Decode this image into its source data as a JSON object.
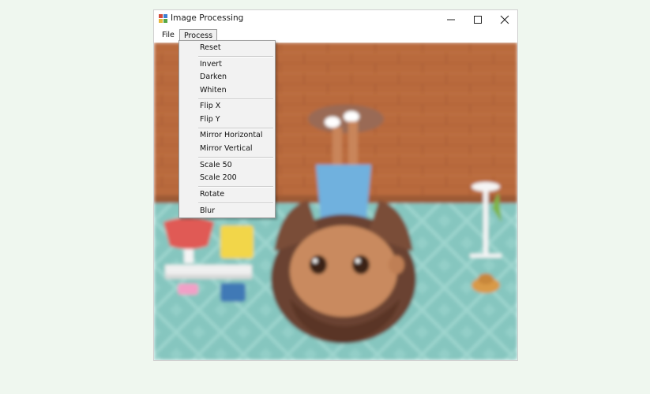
{
  "window": {
    "title": "Image Processing",
    "icon": "app-image-icon",
    "controls": {
      "minimize": "minimize-icon",
      "maximize": "maximize-icon",
      "close": "close-icon"
    }
  },
  "menubar": {
    "file": "File",
    "process": "Process"
  },
  "process_menu": {
    "reset": "Reset",
    "invert": "Invert",
    "darken": "Darken",
    "whiten": "Whiten",
    "flip_x": "Flip X",
    "flip_y": "Flip Y",
    "mirror_horizontal": "Mirror Horizontal",
    "mirror_vertical": "Mirror Vertical",
    "scale_50": "Scale 50",
    "scale_200": "Scale 200",
    "rotate": "Rotate",
    "blur": "Blur"
  },
  "colors": {
    "page_background": "#eff7ef",
    "wood_floor": "#b96a3c",
    "teal_wall": "#86c6bf",
    "menu_background": "#f2f2f2"
  }
}
